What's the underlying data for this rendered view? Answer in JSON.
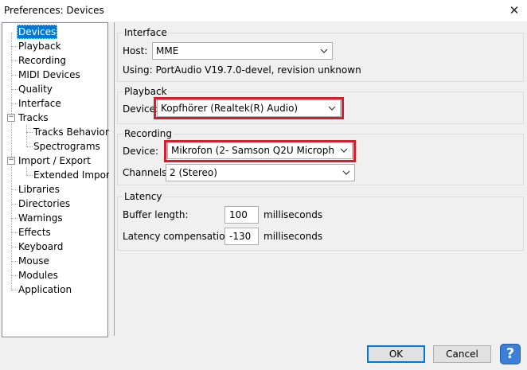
{
  "window": {
    "title": "Preferences: Devices",
    "close_glyph": "✕"
  },
  "tree": {
    "items": [
      {
        "label": "Devices"
      },
      {
        "label": "Playback"
      },
      {
        "label": "Recording"
      },
      {
        "label": "MIDI Devices"
      },
      {
        "label": "Quality"
      },
      {
        "label": "Interface"
      },
      {
        "label": "Tracks"
      },
      {
        "label": "Tracks Behaviors"
      },
      {
        "label": "Spectrograms"
      },
      {
        "label": "Import / Export"
      },
      {
        "label": "Extended Import"
      },
      {
        "label": "Libraries"
      },
      {
        "label": "Directories"
      },
      {
        "label": "Warnings"
      },
      {
        "label": "Effects"
      },
      {
        "label": "Keyboard"
      },
      {
        "label": "Mouse"
      },
      {
        "label": "Modules"
      },
      {
        "label": "Application"
      }
    ],
    "selected": "Devices"
  },
  "interface": {
    "title": "Interface",
    "host_label": "Host:",
    "host_value": "MME",
    "using_text": "Using: PortAudio V19.7.0-devel, revision unknown"
  },
  "playback": {
    "title": "Playback",
    "device_label": "Device:",
    "device_value": "Kopfhörer (Realtek(R) Audio)"
  },
  "recording": {
    "title": "Recording",
    "device_label": "Device:",
    "device_value": "Mikrofon (2- Samson Q2U Microph",
    "channels_label": "Channels:",
    "channels_value": "2 (Stereo)"
  },
  "latency": {
    "title": "Latency",
    "buffer_label": "Buffer length:",
    "buffer_value": "100",
    "buffer_unit": "milliseconds",
    "comp_label": "Latency compensation:",
    "comp_value": "-130",
    "comp_unit": "milliseconds"
  },
  "buttons": {
    "ok": "OK",
    "cancel": "Cancel",
    "help": "?"
  },
  "colors": {
    "selection": "#0078d7",
    "highlight": "#d41f2c",
    "help": "#3c7fd6"
  }
}
